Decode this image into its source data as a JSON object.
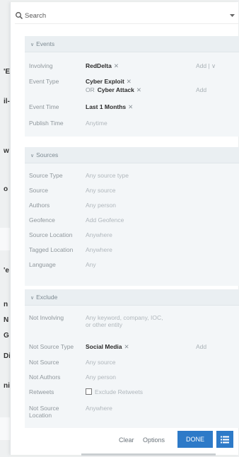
{
  "background": {
    "side_letters": [
      "'E",
      "il-",
      "w",
      "o",
      "'e",
      "n",
      "N",
      "G",
      "Di",
      "ni"
    ]
  },
  "search": {
    "placeholder": "Search"
  },
  "events": {
    "header": "Events",
    "rows": {
      "involving": {
        "label": "Involving",
        "value": "RedDelta",
        "add": "Add | ∨"
      },
      "event_type": {
        "label": "Event Type",
        "value1": "Cyber Exploit",
        "or": "OR",
        "value2": "Cyber Attack",
        "add": "Add"
      },
      "event_time": {
        "label": "Event Time",
        "value": "Last 1 Months"
      },
      "publish_time": {
        "label": "Publish Time",
        "placeholder": "Anytime"
      }
    }
  },
  "sources": {
    "header": "Sources",
    "rows": [
      {
        "label": "Source Type",
        "placeholder": "Any source type"
      },
      {
        "label": "Source",
        "placeholder": "Any source"
      },
      {
        "label": "Authors",
        "placeholder": "Any person"
      },
      {
        "label": "Geofence",
        "placeholder": "Add Geofence"
      },
      {
        "label": "Source Location",
        "placeholder": "Anywhere"
      },
      {
        "label": "Tagged Location",
        "placeholder": "Anywhere"
      },
      {
        "label": "Language",
        "placeholder": "Any"
      }
    ]
  },
  "exclude": {
    "header": "Exclude",
    "rows": {
      "not_involving": {
        "label": "Not Involving",
        "placeholder_line1": "Any keyword, company, IOC,",
        "placeholder_line2": "or other entity"
      },
      "not_source_type": {
        "label": "Not Source Type",
        "value": "Social Media",
        "add": "Add"
      },
      "not_source": {
        "label": "Not Source",
        "placeholder": "Any source"
      },
      "not_authors": {
        "label": "Not Authors",
        "placeholder": "Any person"
      },
      "retweets": {
        "label": "Retweets",
        "checkbox_label": "Exclude Retweets"
      },
      "not_source_location": {
        "label_line1": "Not Source",
        "label_line2": "Location",
        "placeholder": "Anywhere"
      }
    }
  },
  "footer": {
    "clear": "Clear",
    "options": "Options",
    "done": "DONE"
  },
  "icons": {
    "search": "search-icon",
    "dropdown": "chevron-down-icon",
    "list": "list-icon",
    "remove": "close-icon"
  },
  "colors": {
    "primary": "#2d7ac8",
    "section_bg": "#f3f6f8",
    "header_bg": "#eaeff2"
  }
}
